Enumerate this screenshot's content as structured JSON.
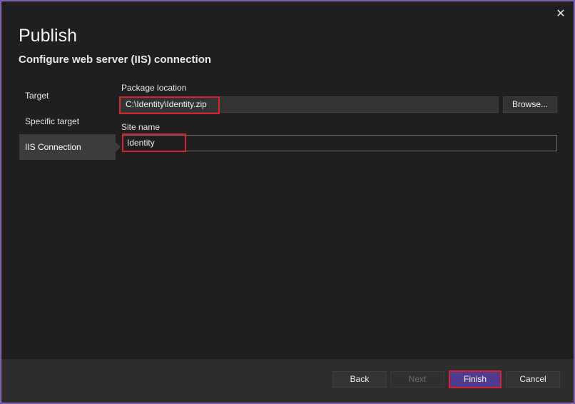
{
  "dialog": {
    "title": "Publish",
    "subtitle": "Configure web server (IIS) connection",
    "close_glyph": "✕"
  },
  "nav": {
    "items": [
      {
        "label": "Target"
      },
      {
        "label": "Specific target"
      },
      {
        "label": "IIS Connection",
        "active": true
      }
    ]
  },
  "form": {
    "package_location_label": "Package location",
    "package_location_value": "C:\\Identity\\Identity.zip",
    "browse_label": "Browse...",
    "site_name_label": "Site name",
    "site_name_value": "Identity"
  },
  "footer": {
    "back_label": "Back",
    "next_label": "Next",
    "finish_label": "Finish",
    "cancel_label": "Cancel"
  },
  "colors": {
    "background": "#1f1f1f",
    "footer": "#2d2d2d",
    "accent": "#4f3a8d",
    "highlight": "#d9232f",
    "frame": "#7b5ea7"
  }
}
